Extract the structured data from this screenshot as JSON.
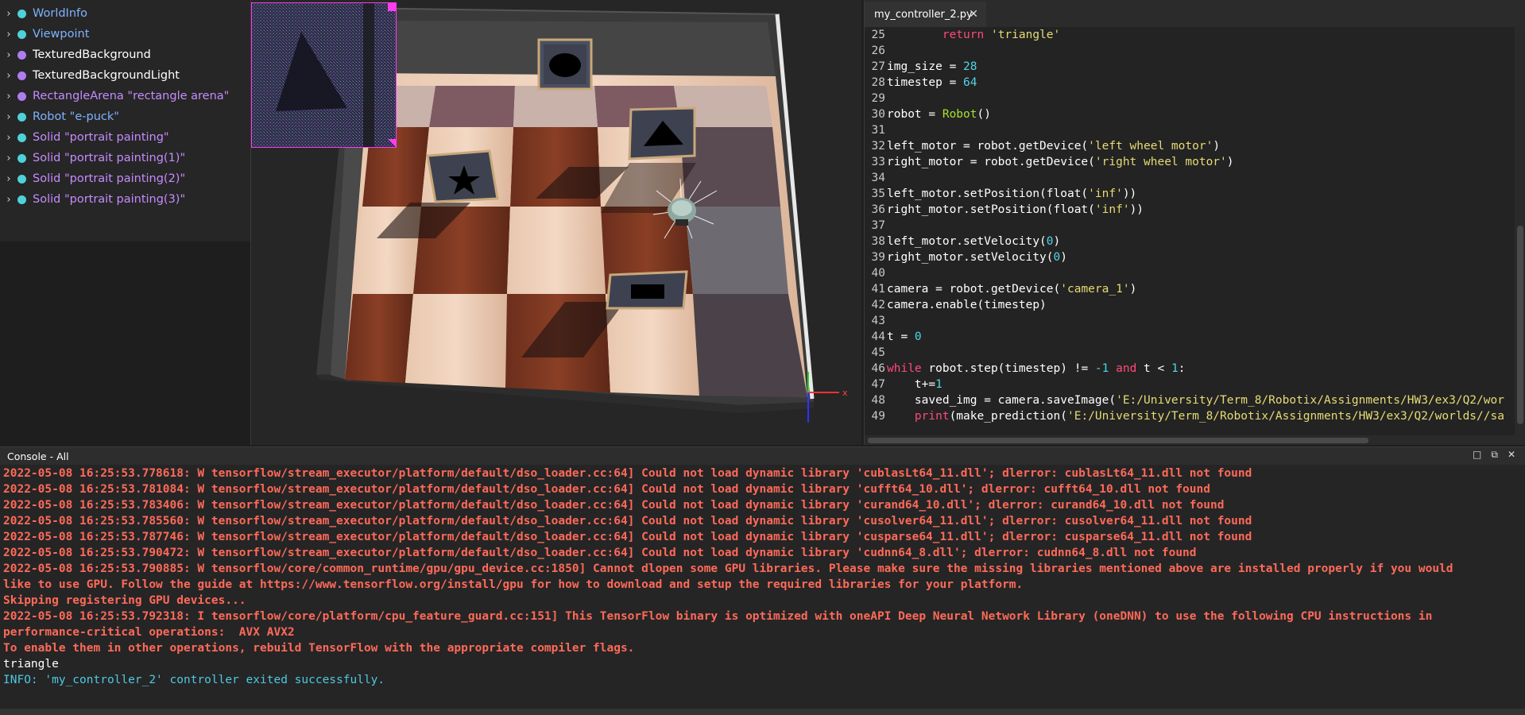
{
  "colors": {
    "teal_dot": "#4fd1d9",
    "purple_dot": "#b07cf2",
    "node_text_blue": "#7fb3ff",
    "node_text_purple": "#c58cff",
    "console_error": "#ff6a58",
    "console_info": "#4ec9e0",
    "kw_pink": "#ff4a7a",
    "str_yellow": "#e6db74",
    "num_cyan": "#4fd6e6",
    "class_green": "#a6e22e"
  },
  "scene_tree": {
    "nodes": [
      {
        "label": "WorldInfo",
        "dot": "teal",
        "text": "blue"
      },
      {
        "label": "Viewpoint",
        "dot": "teal",
        "text": "blue"
      },
      {
        "label": "TexturedBackground",
        "dot": "purple",
        "text": "white"
      },
      {
        "label": "TexturedBackgroundLight",
        "dot": "purple",
        "text": "white"
      },
      {
        "label": "RectangleArena \"rectangle arena\"",
        "dot": "purple",
        "text": "purple"
      },
      {
        "label": "Robot \"e-puck\"",
        "dot": "teal",
        "text": "blue"
      },
      {
        "label": "Solid \"portrait painting\"",
        "dot": "teal",
        "text": "purple"
      },
      {
        "label": "Solid \"portrait painting(1)\"",
        "dot": "teal",
        "text": "purple"
      },
      {
        "label": "Solid \"portrait painting(2)\"",
        "dot": "teal",
        "text": "purple"
      },
      {
        "label": "Solid \"portrait painting(3)\"",
        "dot": "teal",
        "text": "purple"
      }
    ]
  },
  "view3d": {
    "axis_x_label": "x"
  },
  "editor": {
    "tab_label": "my_controller_2.py",
    "tab_close": "✕",
    "lines": [
      {
        "n": "25",
        "segs": [
          [
            "        ",
            "plain"
          ],
          [
            "return",
            "kw"
          ],
          [
            " ",
            "plain"
          ],
          [
            "'triangle'",
            "str"
          ]
        ]
      },
      {
        "n": "26",
        "segs": []
      },
      {
        "n": "27",
        "segs": [
          [
            "img_size = ",
            "plain"
          ],
          [
            "28",
            "num"
          ]
        ]
      },
      {
        "n": "28",
        "segs": [
          [
            "timestep = ",
            "plain"
          ],
          [
            "64",
            "num"
          ]
        ]
      },
      {
        "n": "29",
        "segs": []
      },
      {
        "n": "30",
        "segs": [
          [
            "robot = ",
            "plain"
          ],
          [
            "Robot",
            "cls"
          ],
          [
            "()",
            "plain"
          ]
        ]
      },
      {
        "n": "31",
        "segs": []
      },
      {
        "n": "32",
        "segs": [
          [
            "left_motor = robot.getDevice(",
            "plain"
          ],
          [
            "'left wheel motor'",
            "str"
          ],
          [
            ")",
            "plain"
          ]
        ]
      },
      {
        "n": "33",
        "segs": [
          [
            "right_motor = robot.getDevice(",
            "plain"
          ],
          [
            "'right wheel motor'",
            "str"
          ],
          [
            ")",
            "plain"
          ]
        ]
      },
      {
        "n": "34",
        "segs": []
      },
      {
        "n": "35",
        "segs": [
          [
            "left_motor.setPosition(float(",
            "plain"
          ],
          [
            "'inf'",
            "str"
          ],
          [
            "))",
            "plain"
          ]
        ]
      },
      {
        "n": "36",
        "segs": [
          [
            "right_motor.setPosition(float(",
            "plain"
          ],
          [
            "'inf'",
            "str"
          ],
          [
            "))",
            "plain"
          ]
        ]
      },
      {
        "n": "37",
        "segs": []
      },
      {
        "n": "38",
        "segs": [
          [
            "left_motor.setVelocity(",
            "plain"
          ],
          [
            "0",
            "num"
          ],
          [
            ")",
            "plain"
          ]
        ]
      },
      {
        "n": "39",
        "segs": [
          [
            "right_motor.setVelocity(",
            "plain"
          ],
          [
            "0",
            "num"
          ],
          [
            ")",
            "plain"
          ]
        ]
      },
      {
        "n": "40",
        "segs": []
      },
      {
        "n": "41",
        "segs": [
          [
            "camera = robot.getDevice(",
            "plain"
          ],
          [
            "'camera_1'",
            "str"
          ],
          [
            ")",
            "plain"
          ]
        ]
      },
      {
        "n": "42",
        "segs": [
          [
            "camera.enable(timestep)",
            "plain"
          ]
        ]
      },
      {
        "n": "43",
        "segs": []
      },
      {
        "n": "44",
        "segs": [
          [
            "t = ",
            "plain"
          ],
          [
            "0",
            "num"
          ]
        ]
      },
      {
        "n": "45",
        "segs": []
      },
      {
        "n": "46",
        "segs": [
          [
            "while",
            "kw"
          ],
          [
            " robot.step(timestep) != ",
            "plain"
          ],
          [
            "-1",
            "num"
          ],
          [
            " ",
            "plain"
          ],
          [
            "and",
            "kw"
          ],
          [
            " t < ",
            "plain"
          ],
          [
            "1",
            "num"
          ],
          [
            ":",
            "plain"
          ]
        ]
      },
      {
        "n": "47",
        "segs": [
          [
            "    t+=",
            "plain"
          ],
          [
            "1",
            "num"
          ]
        ]
      },
      {
        "n": "48",
        "segs": [
          [
            "    saved_img = camera.saveImage(",
            "plain"
          ],
          [
            "'E:/University/Term_8/Robotix/Assignments/HW3/ex3/Q2/wor",
            "str"
          ]
        ]
      },
      {
        "n": "49",
        "segs": [
          [
            "    ",
            "plain"
          ],
          [
            "print",
            "kw"
          ],
          [
            "(make_prediction(",
            "plain"
          ],
          [
            "'E:/University/Term_8/Robotix/Assignments/HW3/ex3/Q2/worlds//sa",
            "str"
          ]
        ]
      }
    ]
  },
  "console": {
    "title": "Console - All",
    "controls": [
      "□",
      "⧉",
      "✕"
    ],
    "lines": [
      {
        "t": "2022-05-08 16:25:53.778618: W tensorflow/stream_executor/platform/default/dso_loader.cc:64] Could not load dynamic library 'cublasLt64_11.dll'; dlerror: cublasLt64_11.dll not found",
        "c": "err"
      },
      {
        "t": "2022-05-08 16:25:53.781084: W tensorflow/stream_executor/platform/default/dso_loader.cc:64] Could not load dynamic library 'cufft64_10.dll'; dlerror: cufft64_10.dll not found",
        "c": "err"
      },
      {
        "t": "2022-05-08 16:25:53.783406: W tensorflow/stream_executor/platform/default/dso_loader.cc:64] Could not load dynamic library 'curand64_10.dll'; dlerror: curand64_10.dll not found",
        "c": "err"
      },
      {
        "t": "2022-05-08 16:25:53.785560: W tensorflow/stream_executor/platform/default/dso_loader.cc:64] Could not load dynamic library 'cusolver64_11.dll'; dlerror: cusolver64_11.dll not found",
        "c": "err"
      },
      {
        "t": "2022-05-08 16:25:53.787746: W tensorflow/stream_executor/platform/default/dso_loader.cc:64] Could not load dynamic library 'cusparse64_11.dll'; dlerror: cusparse64_11.dll not found",
        "c": "err"
      },
      {
        "t": "2022-05-08 16:25:53.790472: W tensorflow/stream_executor/platform/default/dso_loader.cc:64] Could not load dynamic library 'cudnn64_8.dll'; dlerror: cudnn64_8.dll not found",
        "c": "err"
      },
      {
        "t": "2022-05-08 16:25:53.790885: W tensorflow/core/common_runtime/gpu/gpu_device.cc:1850] Cannot dlopen some GPU libraries. Please make sure the missing libraries mentioned above are installed properly if you would",
        "c": "err"
      },
      {
        "t": "like to use GPU. Follow the guide at https://www.tensorflow.org/install/gpu for how to download and setup the required libraries for your platform.",
        "c": "err"
      },
      {
        "t": "Skipping registering GPU devices...",
        "c": "err"
      },
      {
        "t": "2022-05-08 16:25:53.792318: I tensorflow/core/platform/cpu_feature_guard.cc:151] This TensorFlow binary is optimized with oneAPI Deep Neural Network Library (oneDNN) to use the following CPU instructions in",
        "c": "err"
      },
      {
        "t": "performance-critical operations:  AVX AVX2",
        "c": "err"
      },
      {
        "t": "To enable them in other operations, rebuild TensorFlow with the appropriate compiler flags.",
        "c": "err"
      },
      {
        "t": "triangle",
        "c": "plain"
      },
      {
        "t": "INFO: 'my_controller_2' controller exited successfully.",
        "c": "info"
      }
    ]
  }
}
